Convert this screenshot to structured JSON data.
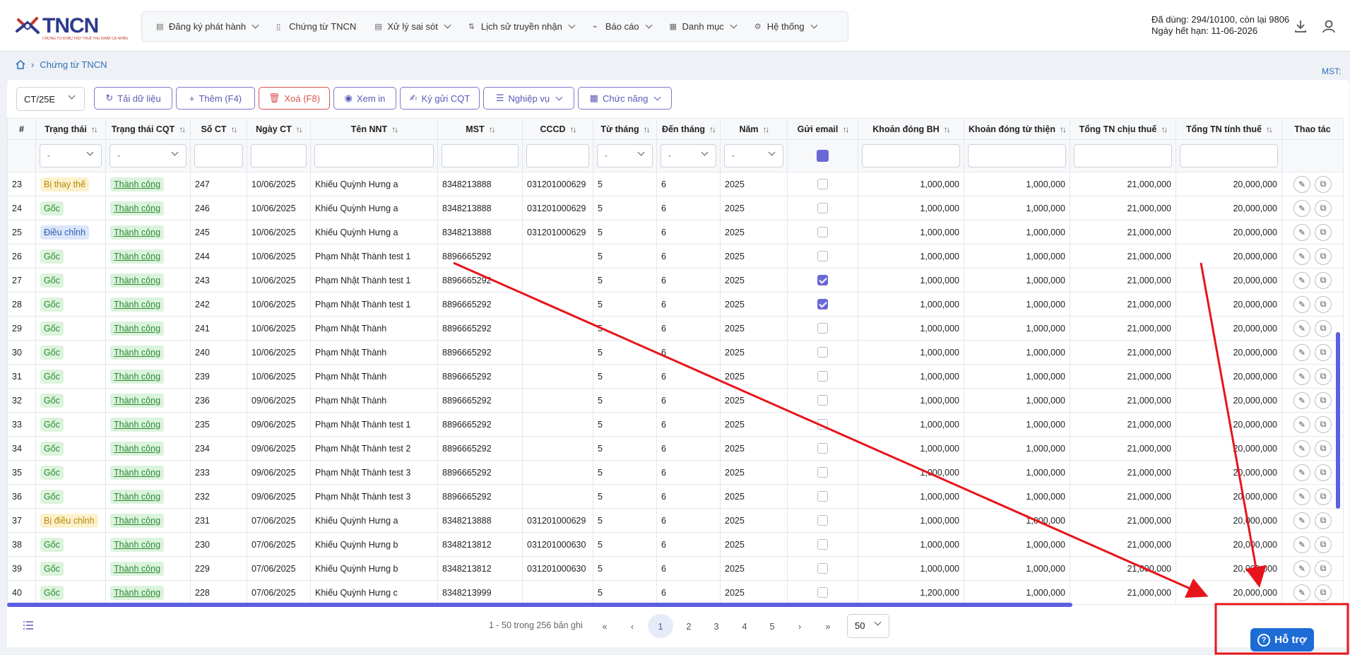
{
  "app": {
    "brand": "TNCN",
    "tagline": "CHỨNG TỪ KHẤU TRỪ THUẾ THU NHẬP CÁ NHÂN"
  },
  "menu": [
    {
      "label": "Đăng ký phát hành",
      "icon": "file-icon"
    },
    {
      "label": "Chứng từ TNCN",
      "icon": "document-icon"
    },
    {
      "label": "Xử lý sai sót",
      "icon": "file-error-icon"
    },
    {
      "label": "Lịch sử truyền nhận",
      "icon": "transfer-icon"
    },
    {
      "label": "Báo cáo",
      "icon": "chart-icon"
    },
    {
      "label": "Danh mục",
      "icon": "grid-icon"
    },
    {
      "label": "Hệ thống",
      "icon": "gear-icon"
    }
  ],
  "usage": {
    "line1": "Đã dùng: 294/10100, còn lại 9806",
    "line2": "Ngày hết hạn: 11-06-2026"
  },
  "breadcrumb": {
    "current": "Chứng từ TNCN"
  },
  "mst_label": "MST:",
  "toolbar": {
    "template": "CT/25E",
    "reload": "Tải dữ liệu",
    "add": "Thêm (F4)",
    "delete": "Xoá (F8)",
    "print": "Xem in",
    "sign_send": "Ký gửi CQT",
    "operations": "Nghiệp vụ",
    "functions": "Chức năng"
  },
  "columns": [
    "#",
    "Trạng thái",
    "Trạng thái CQT",
    "Số CT",
    "Ngày CT",
    "Tên NNT",
    "MST",
    "CCCD",
    "Từ tháng",
    "Đến tháng",
    "Năm",
    "Gửi email",
    "Khoản đóng BH",
    "Khoản đóng từ thiện",
    "Tổng TN chịu thuế",
    "Tổng TN tính thuế",
    "Thao tác"
  ],
  "filter_placeholder": "-",
  "rows": [
    {
      "idx": "23",
      "status": "Bị thay thế",
      "status_cls": "b-btt",
      "cqt": "Thành công",
      "so": "247",
      "ngay": "10/06/2025",
      "ten": "Khiếu Quỳnh Hưng a",
      "mst": "8348213888",
      "cccd": "031201000629",
      "tu": "5",
      "den": "6",
      "nam": "2025",
      "email": false,
      "bh": "1,000,000",
      "tt": "1,000,000",
      "chiu": "21,000,000",
      "tinh": "20,000,000"
    },
    {
      "idx": "24",
      "status": "Gốc",
      "status_cls": "b-goc",
      "cqt": "Thành công",
      "so": "246",
      "ngay": "10/06/2025",
      "ten": "Khiếu Quỳnh Hưng a",
      "mst": "8348213888",
      "cccd": "031201000629",
      "tu": "5",
      "den": "6",
      "nam": "2025",
      "email": false,
      "bh": "1,000,000",
      "tt": "1,000,000",
      "chiu": "21,000,000",
      "tinh": "20,000,000"
    },
    {
      "idx": "25",
      "status": "Điều chỉnh",
      "status_cls": "b-dc",
      "cqt": "Thành công",
      "so": "245",
      "ngay": "10/06/2025",
      "ten": "Khiếu Quỳnh Hưng a",
      "mst": "8348213888",
      "cccd": "031201000629",
      "tu": "5",
      "den": "6",
      "nam": "2025",
      "email": false,
      "bh": "1,000,000",
      "tt": "1,000,000",
      "chiu": "21,000,000",
      "tinh": "20,000,000"
    },
    {
      "idx": "26",
      "status": "Gốc",
      "status_cls": "b-goc",
      "cqt": "Thành công",
      "so": "244",
      "ngay": "10/06/2025",
      "ten": "Phạm Nhật Thành test 1",
      "mst": "8896665292",
      "cccd": "",
      "tu": "5",
      "den": "6",
      "nam": "2025",
      "email": false,
      "bh": "1,000,000",
      "tt": "1,000,000",
      "chiu": "21,000,000",
      "tinh": "20,000,000"
    },
    {
      "idx": "27",
      "status": "Gốc",
      "status_cls": "b-goc",
      "cqt": "Thành công",
      "so": "243",
      "ngay": "10/06/2025",
      "ten": "Phạm Nhật Thành test 1",
      "mst": "8896665292",
      "cccd": "",
      "tu": "5",
      "den": "6",
      "nam": "2025",
      "email": true,
      "bh": "1,000,000",
      "tt": "1,000,000",
      "chiu": "21,000,000",
      "tinh": "20,000,000"
    },
    {
      "idx": "28",
      "status": "Gốc",
      "status_cls": "b-goc",
      "cqt": "Thành công",
      "so": "242",
      "ngay": "10/06/2025",
      "ten": "Phạm Nhật Thành test 1",
      "mst": "8896665292",
      "cccd": "",
      "tu": "5",
      "den": "6",
      "nam": "2025",
      "email": true,
      "bh": "1,000,000",
      "tt": "1,000,000",
      "chiu": "21,000,000",
      "tinh": "20,000,000"
    },
    {
      "idx": "29",
      "status": "Gốc",
      "status_cls": "b-goc",
      "cqt": "Thành công",
      "so": "241",
      "ngay": "10/06/2025",
      "ten": "Phạm Nhật Thành",
      "mst": "8896665292",
      "cccd": "",
      "tu": "5",
      "den": "6",
      "nam": "2025",
      "email": false,
      "bh": "1,000,000",
      "tt": "1,000,000",
      "chiu": "21,000,000",
      "tinh": "20,000,000"
    },
    {
      "idx": "30",
      "status": "Gốc",
      "status_cls": "b-goc",
      "cqt": "Thành công",
      "so": "240",
      "ngay": "10/06/2025",
      "ten": "Phạm Nhật Thành",
      "mst": "8896665292",
      "cccd": "",
      "tu": "5",
      "den": "6",
      "nam": "2025",
      "email": false,
      "bh": "1,000,000",
      "tt": "1,000,000",
      "chiu": "21,000,000",
      "tinh": "20,000,000"
    },
    {
      "idx": "31",
      "status": "Gốc",
      "status_cls": "b-goc",
      "cqt": "Thành công",
      "so": "239",
      "ngay": "10/06/2025",
      "ten": "Phạm Nhật Thành",
      "mst": "8896665292",
      "cccd": "",
      "tu": "5",
      "den": "6",
      "nam": "2025",
      "email": false,
      "bh": "1,000,000",
      "tt": "1,000,000",
      "chiu": "21,000,000",
      "tinh": "20,000,000"
    },
    {
      "idx": "32",
      "status": "Gốc",
      "status_cls": "b-goc",
      "cqt": "Thành công",
      "so": "236",
      "ngay": "09/06/2025",
      "ten": "Phạm Nhật Thành",
      "mst": "8896665292",
      "cccd": "",
      "tu": "5",
      "den": "6",
      "nam": "2025",
      "email": false,
      "bh": "1,000,000",
      "tt": "1,000,000",
      "chiu": "21,000,000",
      "tinh": "20,000,000"
    },
    {
      "idx": "33",
      "status": "Gốc",
      "status_cls": "b-goc",
      "cqt": "Thành công",
      "so": "235",
      "ngay": "09/06/2025",
      "ten": "Phạm Nhật Thành test 1",
      "mst": "8896665292",
      "cccd": "",
      "tu": "5",
      "den": "6",
      "nam": "2025",
      "email": false,
      "bh": "1,000,000",
      "tt": "1,000,000",
      "chiu": "21,000,000",
      "tinh": "20,000,000"
    },
    {
      "idx": "34",
      "status": "Gốc",
      "status_cls": "b-goc",
      "cqt": "Thành công",
      "so": "234",
      "ngay": "09/06/2025",
      "ten": "Phạm Nhật Thành test 2",
      "mst": "8896665292",
      "cccd": "",
      "tu": "5",
      "den": "6",
      "nam": "2025",
      "email": false,
      "bh": "1,000,000",
      "tt": "1,000,000",
      "chiu": "21,000,000",
      "tinh": "20,000,000"
    },
    {
      "idx": "35",
      "status": "Gốc",
      "status_cls": "b-goc",
      "cqt": "Thành công",
      "so": "233",
      "ngay": "09/06/2025",
      "ten": "Phạm Nhật Thành test 3",
      "mst": "8896665292",
      "cccd": "",
      "tu": "5",
      "den": "6",
      "nam": "2025",
      "email": false,
      "bh": "1,000,000",
      "tt": "1,000,000",
      "chiu": "21,000,000",
      "tinh": "20,000,000"
    },
    {
      "idx": "36",
      "status": "Gốc",
      "status_cls": "b-goc",
      "cqt": "Thành công",
      "so": "232",
      "ngay": "09/06/2025",
      "ten": "Phạm Nhật Thành test 3",
      "mst": "8896665292",
      "cccd": "",
      "tu": "5",
      "den": "6",
      "nam": "2025",
      "email": false,
      "bh": "1,000,000",
      "tt": "1,000,000",
      "chiu": "21,000,000",
      "tinh": "20,000,000"
    },
    {
      "idx": "37",
      "status": "Bị điều chỉnh",
      "status_cls": "b-bdc",
      "cqt": "Thành công",
      "so": "231",
      "ngay": "07/06/2025",
      "ten": "Khiếu Quỳnh Hưng a",
      "mst": "8348213888",
      "cccd": "031201000629",
      "tu": "5",
      "den": "6",
      "nam": "2025",
      "email": false,
      "bh": "1,000,000",
      "tt": "1,000,000",
      "chiu": "21,000,000",
      "tinh": "20,000,000"
    },
    {
      "idx": "38",
      "status": "Gốc",
      "status_cls": "b-goc",
      "cqt": "Thành công",
      "so": "230",
      "ngay": "07/06/2025",
      "ten": "Khiếu Quỳnh Hưng b",
      "mst": "8348213812",
      "cccd": "031201000630",
      "tu": "5",
      "den": "6",
      "nam": "2025",
      "email": false,
      "bh": "1,000,000",
      "tt": "1,000,000",
      "chiu": "21,000,000",
      "tinh": "20,000,000"
    },
    {
      "idx": "39",
      "status": "Gốc",
      "status_cls": "b-goc",
      "cqt": "Thành công",
      "so": "229",
      "ngay": "07/06/2025",
      "ten": "Khiếu Quỳnh Hưng b",
      "mst": "8348213812",
      "cccd": "031201000630",
      "tu": "5",
      "den": "6",
      "nam": "2025",
      "email": false,
      "bh": "1,000,000",
      "tt": "1,000,000",
      "chiu": "21,000,000",
      "tinh": "20,000,000"
    },
    {
      "idx": "40",
      "status": "Gốc",
      "status_cls": "b-goc",
      "cqt": "Thành công",
      "so": "228",
      "ngay": "07/06/2025",
      "ten": "Khiếu Quỳnh Hưng c",
      "mst": "8348213999",
      "cccd": "",
      "tu": "5",
      "den": "6",
      "nam": "2025",
      "email": false,
      "bh": "1,200,000",
      "tt": "1,000,000",
      "chiu": "21,000,000",
      "tinh": "20,000,000"
    }
  ],
  "pagination": {
    "info": "1 - 50 trong 256 bản ghi",
    "pages": [
      "1",
      "2",
      "3",
      "4",
      "5"
    ],
    "current": "1",
    "page_size": "50",
    "first": "«",
    "prev": "‹",
    "next": "›",
    "last": "»"
  },
  "help": {
    "label": "Hỗ trợ"
  },
  "colors": {
    "accent": "#5b5fe0",
    "annotation": "#e8141b",
    "help": "#1e6bd6"
  }
}
